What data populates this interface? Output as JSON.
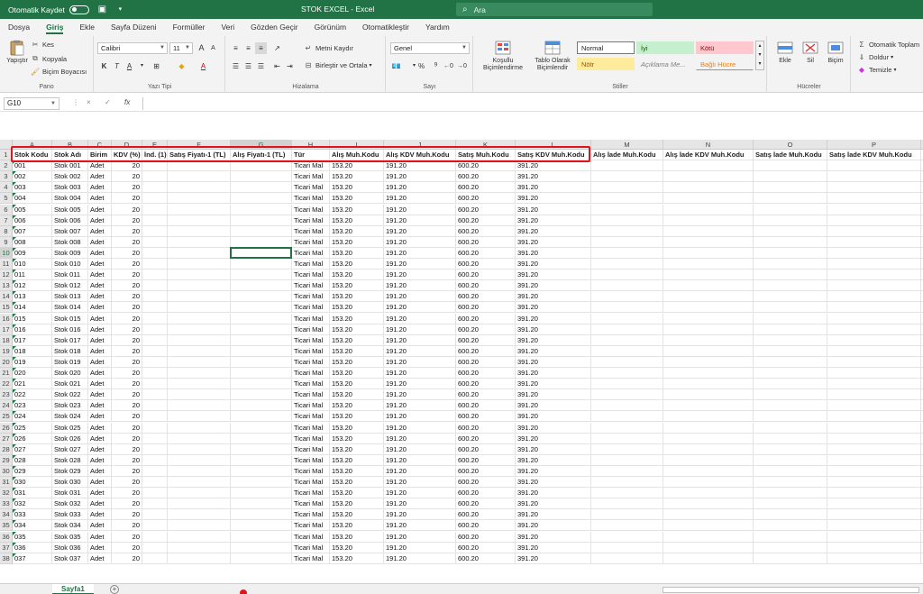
{
  "titlebar": {
    "autosave_label": "Otomatik Kaydet",
    "window_title": "STOK EXCEL  -  Excel",
    "search_placeholder": "Ara"
  },
  "tabs": [
    "Dosya",
    "Giriş",
    "Ekle",
    "Sayfa Düzeni",
    "Formüller",
    "Veri",
    "Gözden Geçir",
    "Görünüm",
    "Otomatikleştir",
    "Yardım"
  ],
  "active_tab": "Giriş",
  "ribbon": {
    "pano": {
      "group_label": "Pano",
      "paste": "Yapıştır",
      "cut": "Kes",
      "copy": "Kopyala",
      "format_painter": "Biçim Boyacısı"
    },
    "font": {
      "group_label": "Yazı Tipi",
      "font_name": "Calibri",
      "font_size": "11",
      "bold": "K",
      "italic": "T",
      "underline": "A",
      "grow": "A",
      "shrink": "A"
    },
    "alignment": {
      "group_label": "Hizalama",
      "wrap_text": "Metni Kaydır",
      "merge_center": "Birleştir ve Ortala"
    },
    "number": {
      "group_label": "Sayı",
      "format": "Genel",
      "percent": "%",
      "comma": "⁹"
    },
    "styles": {
      "group_label": "Stiller",
      "conditional": "Koşullu Biçimlendirme",
      "format_table": "Tablo Olarak Biçimlendir",
      "normal": "Normal",
      "good": "İyi",
      "bad": "Kötü",
      "neutral": "Nötr",
      "explanatory": "Açıklama Me...",
      "linked": "Bağlı Hücre"
    },
    "cells": {
      "group_label": "Hücreler",
      "insert": "Ekle",
      "delete": "Sil",
      "format": "Biçim"
    },
    "editing": {
      "autosum": "Otomatik Toplam",
      "fill": "Doldur",
      "clear": "Temizle"
    }
  },
  "formula_bar": {
    "name_box": "G10",
    "fx": "fx",
    "cancel": "×",
    "confirm": "✓",
    "content": ""
  },
  "grid": {
    "columns": [
      "A",
      "B",
      "C",
      "D",
      "E",
      "F",
      "G",
      "H",
      "I",
      "J",
      "K",
      "L",
      "M",
      "N",
      "O",
      "P"
    ],
    "headers": [
      "Stok Kodu",
      "Stok Adı",
      "Birim",
      "KDV (%)",
      "İnd. (1)",
      "Satış Fiyatı-1 (TL)",
      "Alış Fiyatı-1 (TL)",
      "Tür",
      "Alış Muh.Kodu",
      "Alış KDV Muh.Kodu",
      "Satış Muh.Kodu",
      "Satış KDV Muh.Kodu",
      "Alış İade Muh.Kodu",
      "Alış İade KDV Muh.Kodu",
      "Satış İade Muh.Kodu",
      "Satış İade KDV Muh.Kodu"
    ],
    "row_template": {
      "unit": "Adet",
      "vat": "20",
      "type": "Ticari Mal",
      "purchase_acc": "153.20",
      "purchase_vat_acc": "191.20",
      "sales_acc": "600.20",
      "sales_vat_acc": "391.20"
    },
    "rows": [
      {
        "code": "001",
        "name": "Stok 001"
      },
      {
        "code": "002",
        "name": "Stok 002"
      },
      {
        "code": "003",
        "name": "Stok 003"
      },
      {
        "code": "004",
        "name": "Stok 004"
      },
      {
        "code": "005",
        "name": "Stok 005"
      },
      {
        "code": "006",
        "name": "Stok 006"
      },
      {
        "code": "007",
        "name": "Stok 007"
      },
      {
        "code": "008",
        "name": "Stok 008"
      },
      {
        "code": "009",
        "name": "Stok 009"
      },
      {
        "code": "010",
        "name": "Stok 010"
      },
      {
        "code": "011",
        "name": "Stok 011"
      },
      {
        "code": "012",
        "name": "Stok 012"
      },
      {
        "code": "013",
        "name": "Stok 013"
      },
      {
        "code": "014",
        "name": "Stok 014"
      },
      {
        "code": "015",
        "name": "Stok 015"
      },
      {
        "code": "016",
        "name": "Stok 016"
      },
      {
        "code": "017",
        "name": "Stok 017"
      },
      {
        "code": "018",
        "name": "Stok 018"
      },
      {
        "code": "019",
        "name": "Stok 019"
      },
      {
        "code": "020",
        "name": "Stok 020"
      },
      {
        "code": "021",
        "name": "Stok 021"
      },
      {
        "code": "022",
        "name": "Stok 022"
      },
      {
        "code": "023",
        "name": "Stok 023"
      },
      {
        "code": "024",
        "name": "Stok 024"
      },
      {
        "code": "025",
        "name": "Stok 025"
      },
      {
        "code": "026",
        "name": "Stok 026"
      },
      {
        "code": "027",
        "name": "Stok 027"
      },
      {
        "code": "028",
        "name": "Stok 028"
      },
      {
        "code": "029",
        "name": "Stok 029"
      },
      {
        "code": "030",
        "name": "Stok 030"
      },
      {
        "code": "031",
        "name": "Stok 031"
      },
      {
        "code": "032",
        "name": "Stok 032"
      },
      {
        "code": "033",
        "name": "Stok 033"
      },
      {
        "code": "034",
        "name": "Stok 034"
      },
      {
        "code": "035",
        "name": "Stok 035"
      },
      {
        "code": "036",
        "name": "Stok 036"
      },
      {
        "code": "037",
        "name": "Stok 037"
      }
    ]
  },
  "sheets": {
    "active": "Sayfa1",
    "add": "+"
  },
  "colors": {
    "excel_green": "#217346",
    "highlight_red": "#e0141b"
  }
}
